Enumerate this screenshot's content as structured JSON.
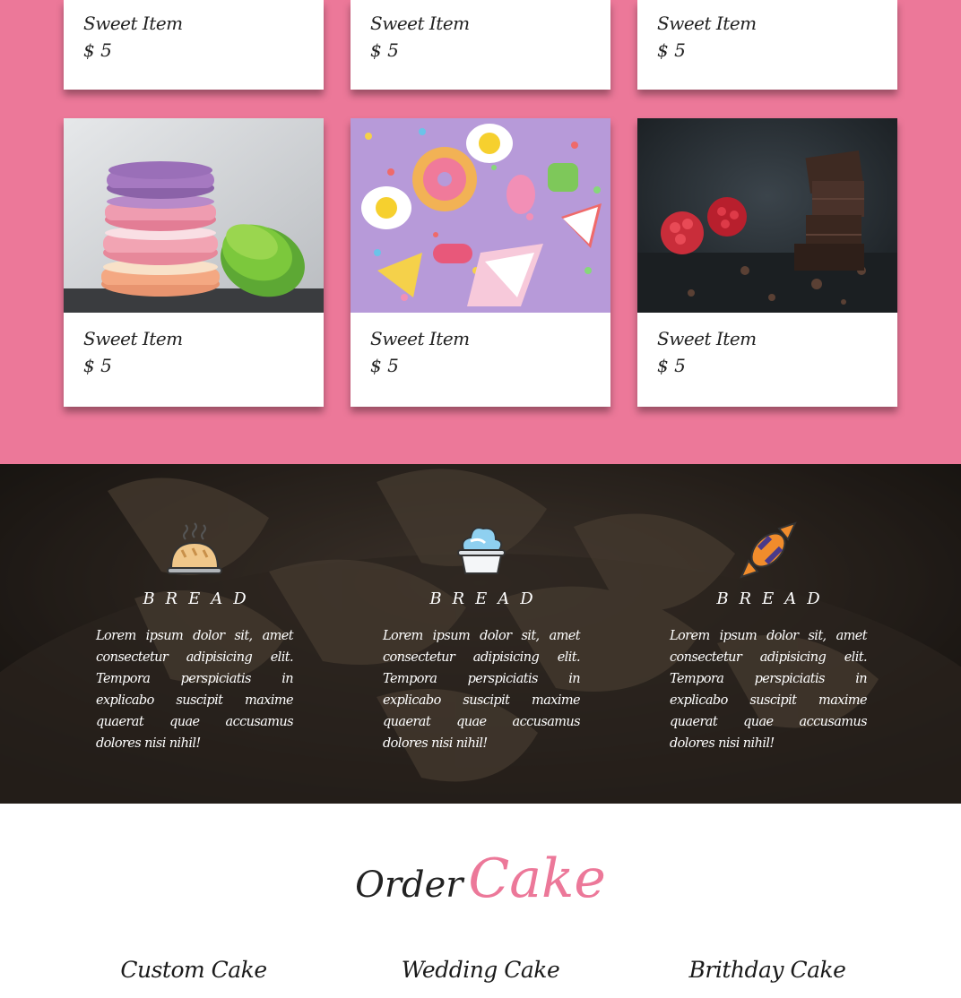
{
  "menu": {
    "items": [
      {
        "name": "Sweet Item",
        "price": "$ 5"
      },
      {
        "name": "Sweet Item",
        "price": "$ 5"
      },
      {
        "name": "Sweet Item",
        "price": "$ 5"
      },
      {
        "name": "Sweet Item",
        "price": "$ 5",
        "image": "macarons-photo"
      },
      {
        "name": "Sweet Item",
        "price": "$ 5",
        "image": "candies-photo"
      },
      {
        "name": "Sweet Item",
        "price": "$ 5",
        "image": "chocolate-raspberry-photo"
      }
    ]
  },
  "features": [
    {
      "icon": "bread-icon",
      "title": "BREAD",
      "text": "Lorem ipsum dolor sit, amet consectetur adipisicing elit. Tempora perspiciatis in explicabo suscipit maxime quaerat quae accusamus dolores nisi nihil!"
    },
    {
      "icon": "cupcake-icon",
      "title": "BREAD",
      "text": "Lorem ipsum dolor sit, amet consectetur adipisicing elit. Tempora perspiciatis in explicabo suscipit maxime quaerat quae accusamus dolores nisi nihil!"
    },
    {
      "icon": "candy-icon",
      "title": "BREAD",
      "text": "Lorem ipsum dolor sit, amet consectetur adipisicing elit. Tempora perspiciatis in explicabo suscipit maxime quaerat quae accusamus dolores nisi nihil!"
    }
  ],
  "order": {
    "title_word1": "Order",
    "title_word2": "Cake",
    "cakes": [
      "Custom Cake",
      "Wedding Cake",
      "Brithday Cake"
    ]
  },
  "colors": {
    "accent": "#ec7899",
    "card_bg": "#ffffff",
    "text_dark": "#222222"
  }
}
